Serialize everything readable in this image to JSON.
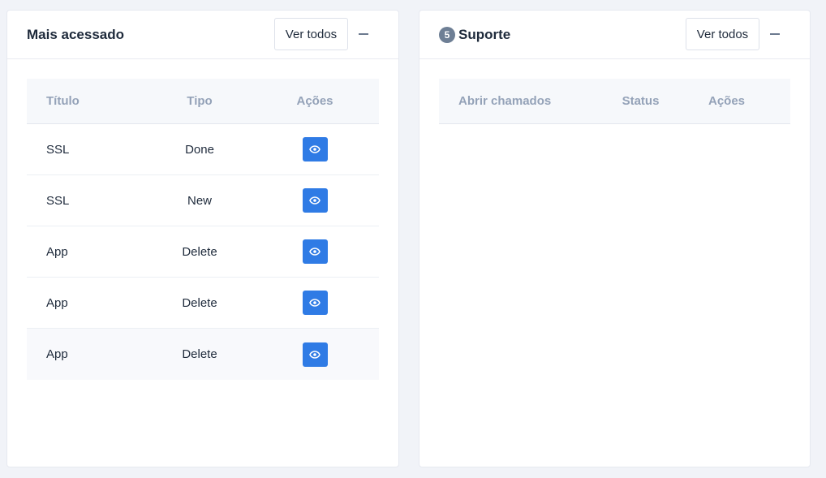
{
  "most_accessed": {
    "title": "Mais acessado",
    "view_all_label": "Ver todos",
    "columns": [
      "Título",
      "Tipo",
      "Ações"
    ],
    "rows": [
      {
        "title": "SSL",
        "type": "Done"
      },
      {
        "title": "SSL",
        "type": "New"
      },
      {
        "title": "App",
        "type": "Delete"
      },
      {
        "title": "App",
        "type": "Delete"
      },
      {
        "title": "App",
        "type": "Delete"
      }
    ],
    "action_icon": "eye-icon"
  },
  "support": {
    "badge_count": "5",
    "title": "Suporte",
    "view_all_label": "Ver todos",
    "columns": [
      "Abrir chamados",
      "Status",
      "Ações"
    ]
  },
  "colors": {
    "accent": "#2f7be5",
    "badge": "#6e7f95",
    "header_text": "#94a2b8"
  }
}
